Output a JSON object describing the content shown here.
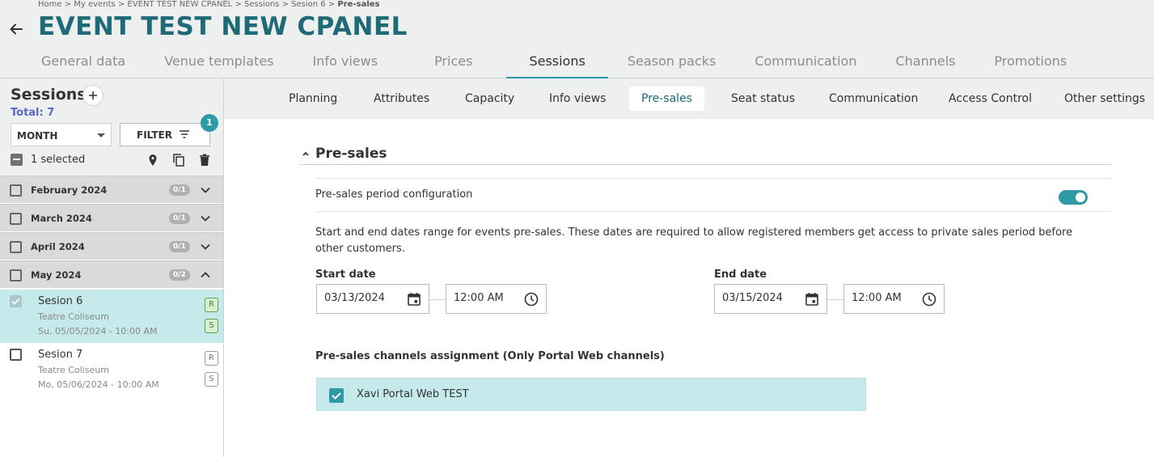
{
  "header": {
    "breadcrumb": {
      "home": "Home",
      "my_events": "My events",
      "event": "EVENT TEST NEW CPANEL",
      "sessions": "Sessions",
      "session": "Sesion 6",
      "current": "Pre-sales",
      "separator": ">"
    },
    "title": "EVENT TEST NEW CPANEL",
    "tabs": [
      "General data",
      "Venue templates",
      "Info views",
      "Prices",
      "Sessions",
      "Season packs",
      "Communication",
      "Channels",
      "Promotions"
    ],
    "active_tab": "Sessions"
  },
  "sidebar": {
    "title": "Sessions",
    "total": "Total: 7",
    "group_by": "MONTH",
    "filter_label": "FILTER",
    "filter_count": "1",
    "selected_label": "1 selected",
    "months": [
      {
        "label": "February 2024",
        "count": "0/1",
        "expanded": false
      },
      {
        "label": "March 2024",
        "count": "0/1",
        "expanded": false
      },
      {
        "label": "April 2024",
        "count": "0/1",
        "expanded": false
      },
      {
        "label": "May 2024",
        "count": "0/2",
        "expanded": true
      }
    ],
    "sessions": [
      {
        "name": "Sesion 6",
        "venue": "Teatre Coliseum",
        "date": "Su, 05/05/2024 - 10:00 AM",
        "tags": [
          "R",
          "S"
        ],
        "selected": true
      },
      {
        "name": "Sesion 7",
        "venue": "Teatre Coliseum",
        "date": "Mo, 05/06/2024 - 10:00 AM",
        "tags": [
          "R",
          "S"
        ],
        "selected": false
      }
    ]
  },
  "subtabs": {
    "items": [
      "Planning",
      "Attributes",
      "Capacity",
      "Info views",
      "Pre-sales",
      "Seat status",
      "Communication",
      "Access Control",
      "Other settings"
    ],
    "active": "Pre-sales"
  },
  "presales": {
    "section_title": "Pre-sales",
    "config_label": "Pre-sales period configuration",
    "config_enabled": true,
    "description": "Start and end dates range for events pre-sales. These dates are required to allow registered members get access to private sales period before other customers.",
    "start_label": "Start date",
    "start_date": "03/13/2024",
    "start_time": "12:00 AM",
    "end_label": "End date",
    "end_date": "03/15/2024",
    "end_time": "12:00 AM",
    "channels_title": "Pre-sales channels assignment (Only Portal Web channels)",
    "channels": [
      {
        "name": "Xavi Portal Web TEST",
        "checked": true
      }
    ]
  },
  "colors": {
    "brand_title": "#1e6b77",
    "accent": "#2e9aa5",
    "selected_bg": "#c6e9ec",
    "total_text": "#5a67c7",
    "tag_green": "#56a64a"
  }
}
